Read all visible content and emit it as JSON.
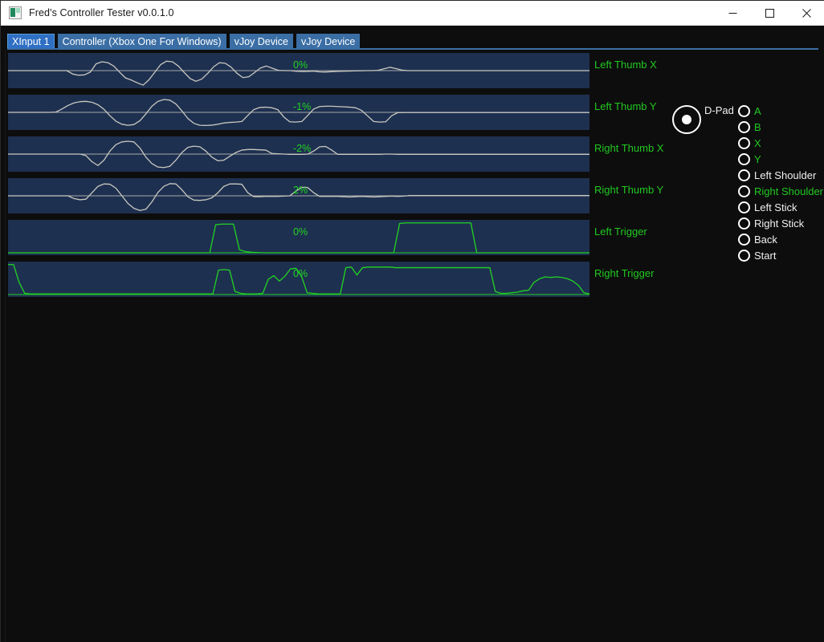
{
  "window": {
    "title": "Fred's Controller Tester v0.0.1.0",
    "icon": "app-icon",
    "controls": {
      "minimize": "minimize-icon",
      "maximize": "maximize-icon",
      "close": "close-icon"
    }
  },
  "tabs": [
    {
      "label": "XInput 1",
      "active": true
    },
    {
      "label": "Controller (Xbox One For Windows)",
      "active": false
    },
    {
      "label": "vJoy Device",
      "active": false
    },
    {
      "label": "vJoy Device",
      "active": false
    }
  ],
  "graphs": [
    {
      "label": "Left Thumb X",
      "value": "0%",
      "type": "axis"
    },
    {
      "label": "Left Thumb Y",
      "value": "-1%",
      "type": "axis"
    },
    {
      "label": "Right Thumb X",
      "value": "-2%",
      "type": "axis"
    },
    {
      "label": "Right Thumb Y",
      "value": "2%",
      "type": "axis"
    },
    {
      "label": "Left Trigger",
      "value": "0%",
      "type": "trigger"
    },
    {
      "label": "Right Trigger",
      "value": "0%",
      "type": "trigger"
    }
  ],
  "dpad": {
    "label": "D-Pad",
    "pressed": true
  },
  "buttons": [
    {
      "label": "A",
      "active": true
    },
    {
      "label": "B",
      "active": true
    },
    {
      "label": "X",
      "active": true
    },
    {
      "label": "Y",
      "active": true
    },
    {
      "label": "Left Shoulder",
      "active": false
    },
    {
      "label": "Right Shoulder",
      "active": true
    },
    {
      "label": "Left Stick",
      "active": false
    },
    {
      "label": "Right Stick",
      "active": false
    },
    {
      "label": "Back",
      "active": false
    },
    {
      "label": "Start",
      "active": false
    }
  ],
  "colors": {
    "accent_green": "#21c821",
    "inactive_text": "#f0f0f0",
    "graph_bg": "#1e3050",
    "graph_line": "#c8c8c0",
    "trigger_line": "#21d421",
    "tab_blue": "#3a6ea5",
    "tab_active_blue": "#2f6fc4",
    "window_bg": "#0d0d0d"
  },
  "chart_data": [
    {
      "type": "line",
      "title": "Left Thumb X",
      "ylabel": "percent",
      "ylim": [
        -100,
        100
      ],
      "current_value": 0,
      "baseline": 0,
      "points": [
        0,
        0,
        0,
        0,
        0,
        0,
        0,
        0,
        0,
        0,
        0,
        -22,
        -30,
        -28,
        -10,
        45,
        58,
        52,
        30,
        -10,
        -48,
        -62,
        -80,
        -95,
        -60,
        -10,
        40,
        62,
        58,
        30,
        -12,
        -52,
        -70,
        -55,
        -18,
        25,
        52,
        48,
        22,
        -18,
        -46,
        -40,
        -12,
        18,
        30,
        16,
        2,
        0,
        0,
        -4,
        -6,
        -5,
        -3,
        -8,
        -9,
        -7,
        -5,
        -4,
        -3,
        -2,
        -1,
        0,
        0,
        2,
        12,
        22,
        14,
        4,
        0,
        0,
        0,
        0,
        0,
        0,
        0,
        0,
        0,
        0,
        0,
        0,
        0,
        0,
        0,
        0,
        0,
        0,
        0,
        0,
        0,
        0,
        0,
        0,
        0,
        0,
        0,
        0,
        0,
        0,
        0,
        0
      ]
    },
    {
      "type": "line",
      "title": "Left Thumb Y",
      "ylabel": "percent",
      "ylim": [
        -100,
        100
      ],
      "current_value": -1,
      "baseline": 0,
      "points": [
        0,
        0,
        0,
        0,
        0,
        0,
        0,
        0,
        2,
        22,
        45,
        62,
        70,
        72,
        66,
        50,
        20,
        -22,
        -58,
        -78,
        -85,
        -80,
        -55,
        -10,
        40,
        72,
        84,
        80,
        55,
        10,
        -40,
        -72,
        -85,
        -86,
        -84,
        -78,
        -70,
        -66,
        -64,
        -60,
        -20,
        18,
        32,
        34,
        30,
        18,
        -30,
        -62,
        -64,
        -60,
        -20,
        22,
        38,
        40,
        40,
        38,
        36,
        34,
        30,
        12,
        -24,
        -60,
        -64,
        -62,
        -22,
        -2,
        -1,
        -1,
        -1,
        -1,
        -1,
        -1,
        -1,
        -1,
        -1,
        -1,
        -1,
        -1,
        -1,
        -1,
        -1,
        -1,
        -1,
        -1,
        -1,
        -1,
        -1,
        -1,
        -1,
        -1,
        -1,
        -1,
        -1,
        -1,
        -1,
        -1,
        -1,
        -1
      ]
    },
    {
      "type": "line",
      "title": "Right Thumb X",
      "ylabel": "percent",
      "ylim": [
        -100,
        100
      ],
      "current_value": -2,
      "baseline": 0,
      "points": [
        0,
        0,
        0,
        0,
        0,
        0,
        0,
        0,
        0,
        0,
        0,
        0,
        0,
        -10,
        -50,
        -75,
        -40,
        20,
        62,
        80,
        84,
        80,
        40,
        -20,
        -62,
        -85,
        -88,
        -80,
        -40,
        10,
        44,
        52,
        48,
        20,
        -20,
        -44,
        -40,
        -14,
        10,
        26,
        30,
        30,
        28,
        26,
        4,
        2,
        0,
        -2,
        -2,
        -2,
        0,
        20,
        48,
        50,
        26,
        -2,
        -2,
        -2,
        -2,
        -2,
        -2,
        -2,
        -2,
        0,
        0,
        -2,
        -2,
        -2,
        -2,
        -2,
        -2,
        -2,
        -2,
        -2,
        -2,
        -2,
        -2,
        -2,
        -2,
        -2,
        -2,
        -2,
        -2,
        -2,
        -2,
        -2,
        -2,
        -2,
        -2,
        -2,
        -2,
        -2,
        -2,
        -2,
        -2,
        -2,
        -2,
        -2
      ]
    },
    {
      "type": "line",
      "title": "Right Thumb Y",
      "ylabel": "percent",
      "ylim": [
        -100,
        100
      ],
      "current_value": 2,
      "baseline": 0,
      "points": [
        0,
        0,
        0,
        0,
        0,
        0,
        0,
        0,
        0,
        0,
        0,
        -18,
        -26,
        -22,
        20,
        62,
        78,
        76,
        50,
        0,
        -50,
        -82,
        -96,
        -88,
        -40,
        22,
        62,
        80,
        78,
        40,
        -6,
        -28,
        -30,
        -26,
        -14,
        20,
        62,
        78,
        78,
        76,
        20,
        -6,
        -6,
        -4,
        -4,
        -4,
        -2,
        0,
        30,
        56,
        54,
        20,
        -4,
        -4,
        -4,
        -4,
        -6,
        -8,
        -6,
        -4,
        -6,
        -8,
        -6,
        -4,
        -2,
        -4,
        -2,
        2,
        2,
        2,
        2,
        2,
        2,
        2,
        2,
        2,
        2,
        2,
        2,
        2,
        2,
        2,
        2,
        2,
        2,
        2,
        2,
        2,
        2,
        2,
        2,
        2,
        2,
        2,
        2,
        2,
        2,
        2
      ]
    },
    {
      "type": "line",
      "title": "Left Trigger",
      "ylabel": "percent",
      "ylim": [
        0,
        100
      ],
      "current_value": 0,
      "baseline": 0,
      "points": [
        0,
        0,
        0,
        0,
        0,
        0,
        0,
        0,
        0,
        0,
        0,
        0,
        0,
        0,
        0,
        0,
        0,
        0,
        0,
        0,
        0,
        0,
        0,
        0,
        0,
        0,
        0,
        0,
        0,
        0,
        0,
        0,
        0,
        0,
        0,
        92,
        94,
        94,
        94,
        10,
        4,
        2,
        1,
        0,
        0,
        0,
        0,
        0,
        0,
        0,
        0,
        0,
        0,
        0,
        0,
        0,
        0,
        0,
        0,
        0,
        0,
        0,
        0,
        0,
        0,
        0,
        96,
        98,
        98,
        98,
        98,
        98,
        98,
        98,
        98,
        98,
        98,
        98,
        98,
        0,
        0,
        0,
        0,
        0,
        0,
        0,
        0,
        0,
        0,
        0,
        0,
        0,
        0,
        0,
        0,
        0,
        0,
        0,
        0
      ]
    },
    {
      "type": "line",
      "title": "Right Trigger",
      "ylabel": "percent",
      "ylim": [
        0,
        100
      ],
      "current_value": 0,
      "baseline": 0,
      "points": [
        98,
        98,
        40,
        4,
        2,
        2,
        2,
        2,
        2,
        2,
        2,
        2,
        2,
        2,
        2,
        2,
        2,
        2,
        2,
        2,
        2,
        2,
        2,
        2,
        2,
        2,
        2,
        2,
        2,
        2,
        2,
        2,
        2,
        2,
        2,
        2,
        2,
        2,
        80,
        82,
        80,
        10,
        4,
        2,
        2,
        2,
        4,
        50,
        62,
        44,
        60,
        84,
        86,
        60,
        6,
        4,
        2,
        2,
        2,
        2,
        2,
        88,
        90,
        64,
        88,
        90,
        90,
        90,
        90,
        90,
        88,
        88,
        88,
        88,
        88,
        88,
        88,
        88,
        88,
        88,
        88,
        88,
        88,
        88,
        88,
        88,
        88,
        88,
        10,
        4,
        4,
        6,
        8,
        12,
        14,
        40,
        52,
        58,
        56,
        58,
        56,
        52,
        44,
        30,
        6,
        2
      ]
    }
  ]
}
